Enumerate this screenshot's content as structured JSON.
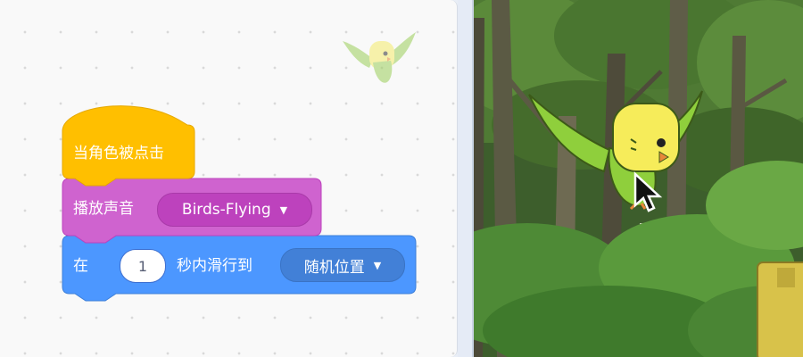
{
  "code_area": {
    "hat_block": {
      "label": "当角色被点击",
      "color": "#ffbf00"
    },
    "sound_block": {
      "label": "播放声音",
      "sound_value": "Birds-Flying",
      "color": "#cf63cf",
      "dropdown_icon": "caret-down-icon"
    },
    "glide_block": {
      "label_prefix": "在",
      "seconds_value": "1",
      "label_middle": "秒内滑行到",
      "target_value": "随机位置",
      "color": "#4c97ff",
      "dropdown_icon": "caret-down-icon"
    },
    "ghost_sprite": "parakeet-sprite-icon"
  },
  "stage": {
    "backdrop": "forest-backdrop",
    "sprite": "parakeet-sprite",
    "cursor": "mouse-pointer-icon"
  }
}
